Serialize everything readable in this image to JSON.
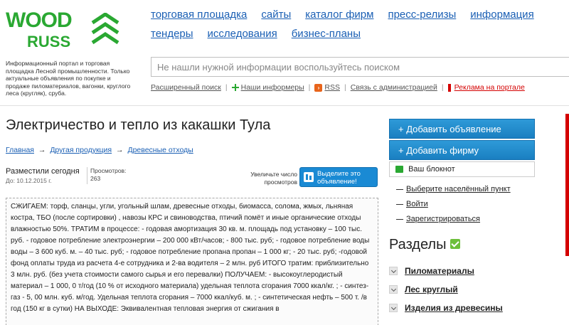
{
  "logo": {
    "word1": "WOOD",
    "word2": "RUSS",
    "color": "#2aa832"
  },
  "tagline": "Информационный портал и торговая площадка Лесной промышленности. Только актуальные объявления по покупке и продаже пиломатериалов, вагонки, круглого леса (кругляк), сруба.",
  "nav": {
    "row1": [
      "торговая площадка",
      "сайты",
      "каталог фирм",
      "пресс-релизы",
      "информация"
    ],
    "row2": [
      "тендеры",
      "исследования",
      "бизнес-планы"
    ]
  },
  "search": {
    "placeholder": "Не нашли нужной информации воспользуйтесь поиском"
  },
  "sublinks": {
    "advanced": "Расширенный поиск",
    "informers": "Наши информеры",
    "rss": "RSS",
    "contact": "Связь с администрацией",
    "ads": "Реклама на портале"
  },
  "page": {
    "title": "Электричество и тепло из какашки Тула",
    "breadcrumbs": [
      "Главная",
      "Другая продукция",
      "Древесные отходы"
    ],
    "posted_label": "Разместили сегодня",
    "posted_date": "До: 10.12.2015 г.",
    "views_label": "Просмотров:",
    "views_count": "263",
    "highlight_note": "Увеличьте число просмотров",
    "highlight_button": "Выделите это объявление!",
    "description": "СЖИГАЕМ: торф, сланцы, угли, угольный шлам, древесные отходы, биомасса, солома, жмых, льняная костра, ТБО (после сортировки) , навозы КРС и свиноводства, птичий помёт и иные органические отходы влажностью 50%. ТРАТИМ в процессе: - годовая амортизация 30 кв. м. площадь под установку – 100 тыс. руб. - годовое потребление электроэнергии – 200 000 кВт/часов; - 800 тыс. руб; - годовое потребление воды воды – 3 600 куб. м. – 40 тыс. руб; - годовое потребление пропана пропан – 1 000 кг; - 20 тыс. руб; -годовой фонд оплаты труда из расчета 4-е сотрудника и 2-ва водителя – 2 млн. руб ИТОГО тратим: приблизительно 3 млн. руб. (без учета стоимости самого сырья и его перевалки) ПОЛУЧАЕМ: - высокоуглеродистый материал – 1 000, 0 т/год (10 % от исходного материала) удельная теплота сгорания 7000 ккал/кг. ; - синтез-газ - 5, 00 млн. куб. м/год. Удельная теплота сгорания – 7000 ккал/куб. м. ; - синтетическая нефть – 500 т. /в год (150 кг в сутки) НА ВЫХОДЕ: Эквивалентная тепловая энергия от сжигания в"
  },
  "sidebar": {
    "add_ad": "+ Добавить объявление",
    "add_firm": "+ Добавить фирму",
    "notebook": "Ваш блокнот",
    "links": [
      "Выберите населённый пункт",
      "Войти",
      "Зарегистрироваться"
    ],
    "sections_title": "Разделы",
    "sections": [
      "Пиломатериалы",
      "Лес круглый",
      "Изделия из древесины"
    ]
  }
}
